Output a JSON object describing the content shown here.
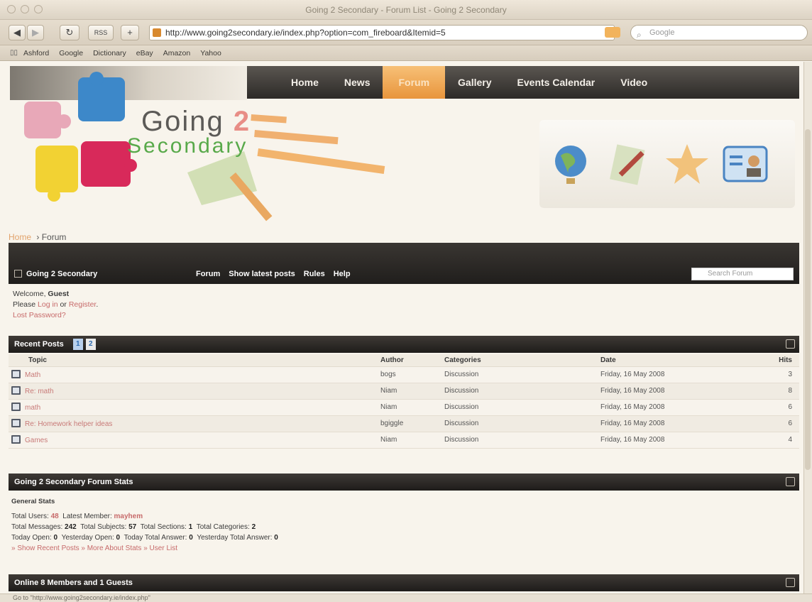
{
  "window": {
    "title": "Going 2 Secondary - Forum List - Going 2 Secondary"
  },
  "toolbar": {
    "back": "◀",
    "forward": "▶",
    "reload": "↻",
    "rss": "RSS",
    "add": "+",
    "url": "http://www.going2secondary.ie/index.php?option=com_fireboard&Itemid=5",
    "search_placeholder": "Google"
  },
  "bookmarks": [
    "Ashford",
    "Google",
    "Dictionary",
    "eBay",
    "Amazon",
    "Yahoo"
  ],
  "nav": {
    "items": [
      "Home",
      "News",
      "Forum",
      "Gallery",
      "Events Calendar",
      "Video"
    ],
    "active_index": 2
  },
  "logo": {
    "line1": "Going",
    "two": "2",
    "line2": "Secondary"
  },
  "breadcrumb": {
    "home": "Home",
    "sep": "›",
    "current": "Forum"
  },
  "forum_bar": {
    "title": "Going 2 Secondary",
    "links": [
      "Forum",
      "Show latest posts",
      "Rules",
      "Help"
    ],
    "search_placeholder": "Search Forum"
  },
  "welcome": {
    "line1_a": "Welcome, ",
    "user": "Guest",
    "line2_a": "Please ",
    "login": "Log in",
    "or": " or ",
    "register": "Register",
    "period": ".",
    "lost": "Lost Password?"
  },
  "recent_posts": {
    "title": "Recent Posts",
    "pages": [
      "1",
      "2"
    ],
    "columns": [
      "Topic",
      "Author",
      "Categories",
      "Date",
      "Hits"
    ],
    "rows": [
      {
        "topic": "Math",
        "author": "bogs",
        "category": "Discussion",
        "date": "Friday, 16 May 2008",
        "hits": "3"
      },
      {
        "topic": "Re: math",
        "author": "Niam",
        "category": "Discussion",
        "date": "Friday, 16 May 2008",
        "hits": "8"
      },
      {
        "topic": "math",
        "author": "Niam",
        "category": "Discussion",
        "date": "Friday, 16 May 2008",
        "hits": "6"
      },
      {
        "topic": "Re: Homework helper ideas",
        "author": "bgiggle",
        "category": "Discussion",
        "date": "Friday, 16 May 2008",
        "hits": "6"
      },
      {
        "topic": "Games",
        "author": "Niam",
        "category": "Discussion",
        "date": "Friday, 16 May 2008",
        "hits": "4"
      }
    ]
  },
  "stats": {
    "title": "Going 2 Secondary Forum Stats",
    "general": "General Stats",
    "total_users_label": "Total Users: ",
    "total_users": "48",
    "latest_member_label": "Latest Member: ",
    "latest_member": "mayhem",
    "total_messages_label": "Total Messages: ",
    "total_messages": "242",
    "total_subjects_label": "Total Subjects: ",
    "total_subjects": "57",
    "total_sections_label": "Total Sections: ",
    "total_sections": "1",
    "total_categories_label": "Total Categories: ",
    "total_categories": "2",
    "today_open_label": "Today Open: ",
    "today_open": "0",
    "yesterday_open_label": "Yesterday Open: ",
    "yesterday_open": "0",
    "today_answer_label": "Today Total Answer: ",
    "today_answer": "0",
    "yesterday_answer_label": "Yesterday Total Answer: ",
    "yesterday_answer": "0",
    "links": "» Show Recent Posts » More About Stats » User List"
  },
  "online": {
    "prefix": "Online ",
    "count": "8",
    "suffix": " Members and 1 Guests"
  },
  "status": "Go to \"http://www.going2secondary.ie/index.php\""
}
